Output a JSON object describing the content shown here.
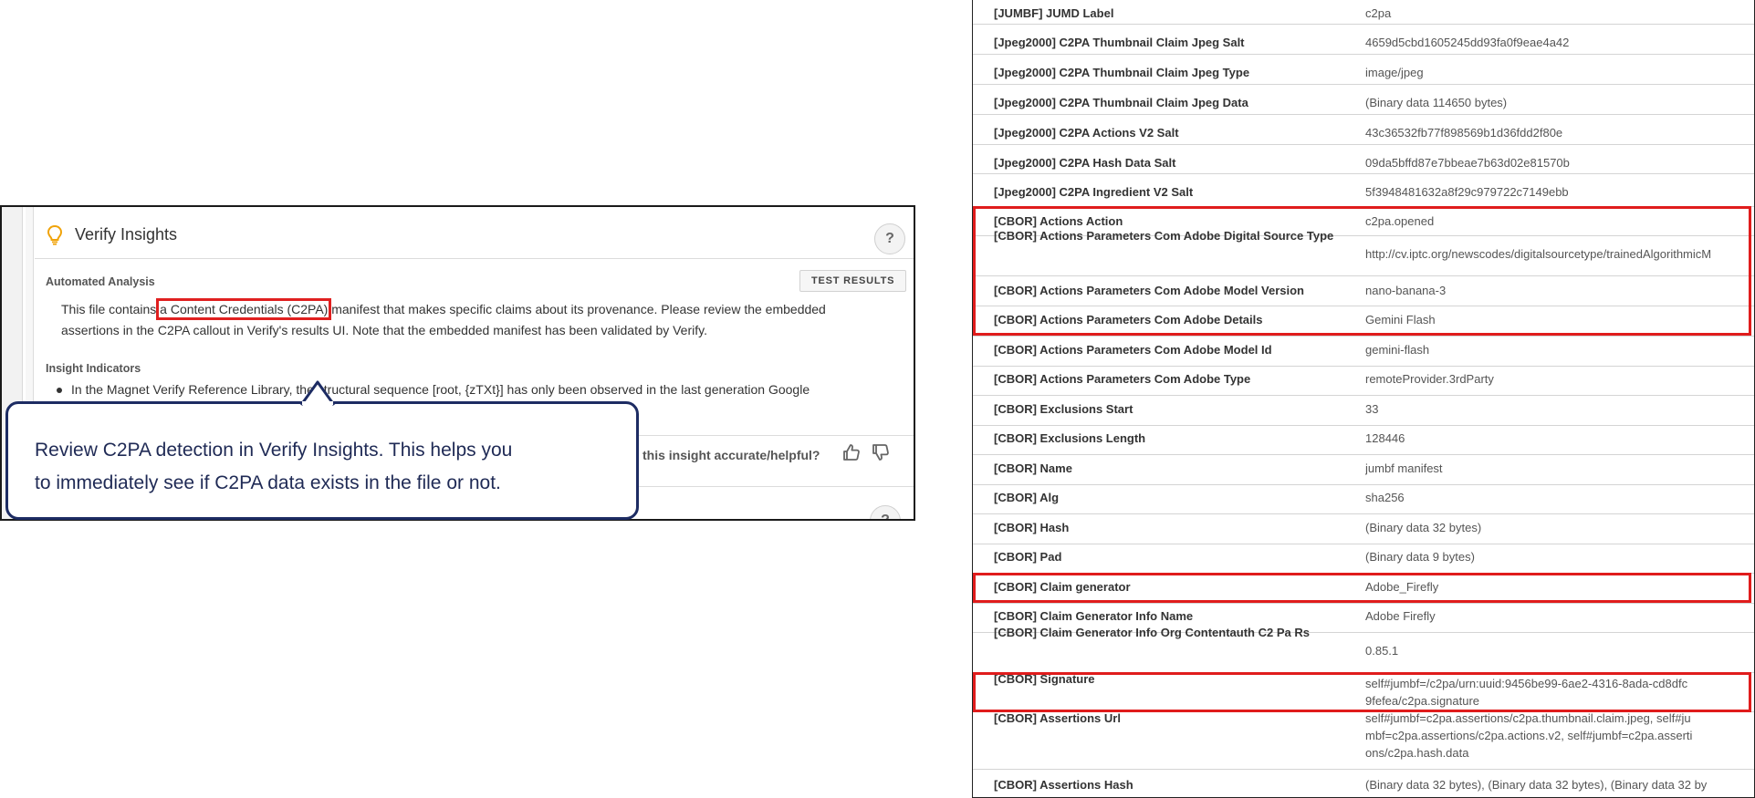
{
  "insights": {
    "title": "Verify Insights",
    "help_label": "?",
    "automated_analysis_label": "Automated Analysis",
    "test_results_label": "TEST RESULTS",
    "analysis_pre": "This file contains ",
    "analysis_highlight": "a Content Credentials (C2PA)",
    "analysis_post_line1": " manifest that makes specific claims about its provenance. Please review the embedded",
    "analysis_line2": "assertions in the C2PA callout in Verify's results UI. Note that the embedded manifest has been validated by Verify.",
    "insight_indicators_label": "Insight Indicators",
    "indicator_text": "In the Magnet Verify Reference Library, the structural sequence [root, {zTXt}] has only been observed in the last generation Google",
    "feedback_question": "this insight accurate/helpful?"
  },
  "callout": {
    "text_line1": "Review C2PA detection in Verify Insights. This helps you",
    "text_line2": "to immediately see if C2PA data exists in the file or not."
  },
  "metadata": {
    "rows": [
      {
        "key": "[JUMBF] JUMD Label",
        "value": "c2pa"
      },
      {
        "key": "[Jpeg2000] C2PA Thumbnail Claim Jpeg Salt",
        "value": "4659d5cbd1605245dd93fa0f9eae4a42"
      },
      {
        "key": "[Jpeg2000] C2PA Thumbnail Claim Jpeg Type",
        "value": "image/jpeg"
      },
      {
        "key": "[Jpeg2000] C2PA Thumbnail Claim Jpeg Data",
        "value": "(Binary data 114650 bytes)"
      },
      {
        "key": "[Jpeg2000] C2PA Actions V2 Salt",
        "value": "43c36532fb77f898569b1d36fdd2f80e"
      },
      {
        "key": "[Jpeg2000] C2PA Hash Data Salt",
        "value": "09da5bffd87e7bbeae7b63d02e81570b"
      },
      {
        "key": "[Jpeg2000] C2PA Ingredient V2 Salt",
        "value": "5f3948481632a8f29c979722c7149ebb"
      },
      {
        "key": "[CBOR] Actions Action",
        "value": "c2pa.opened"
      },
      {
        "key": "[CBOR] Actions Parameters Com Adobe Digital Source Type",
        "value": "http://cv.iptc.org/newscodes/digitalsourcetype/trainedAlgorithmicM"
      },
      {
        "key": "[CBOR] Actions Parameters Com Adobe Model Version",
        "value": "nano-banana-3"
      },
      {
        "key": "[CBOR] Actions Parameters Com Adobe Details",
        "value": "Gemini Flash"
      },
      {
        "key": "[CBOR] Actions Parameters Com Adobe Model Id",
        "value": "gemini-flash"
      },
      {
        "key": "[CBOR] Actions Parameters Com Adobe Type",
        "value": "remoteProvider.3rdParty"
      },
      {
        "key": "[CBOR] Exclusions Start",
        "value": "33"
      },
      {
        "key": "[CBOR] Exclusions Length",
        "value": "128446"
      },
      {
        "key": "[CBOR] Name",
        "value": "jumbf manifest"
      },
      {
        "key": "[CBOR] Alg",
        "value": "sha256"
      },
      {
        "key": "[CBOR] Hash",
        "value": "(Binary data 32 bytes)"
      },
      {
        "key": "[CBOR] Pad",
        "value": "(Binary data 9 bytes)"
      },
      {
        "key": "[CBOR] Claim generator",
        "value": "Adobe_Firefly"
      },
      {
        "key": "[CBOR] Claim Generator Info Name",
        "value": "Adobe Firefly"
      },
      {
        "key": "[CBOR] Claim Generator Info Org Contentauth C2 Pa Rs",
        "value": "0.85.1"
      },
      {
        "key": "[CBOR] Signature",
        "value": "self#jumbf=/c2pa/urn:uuid:9456be99-6ae2-4316-8ada-cd8dfc9fefea/c2pa.signature"
      },
      {
        "key": "[CBOR] Assertions Url",
        "value": "self#jumbf=c2pa.assertions/c2pa.thumbnail.claim.jpeg, self#jumbf=c2pa.assertions/c2pa.actions.v2, self#jumbf=c2pa.assertions/c2pa.hash.data"
      },
      {
        "key": "[CBOR] Assertions Hash",
        "value": "(Binary data 32 bytes), (Binary data 32 bytes), (Binary data 32 by"
      }
    ]
  },
  "colors": {
    "highlight": "#e01c1c",
    "callout_border": "#1d2c63",
    "bulb": "#f0a30a"
  },
  "icons": [
    "lightbulb-icon",
    "thumbs-up-icon",
    "thumbs-down-icon",
    "help-icon"
  ]
}
